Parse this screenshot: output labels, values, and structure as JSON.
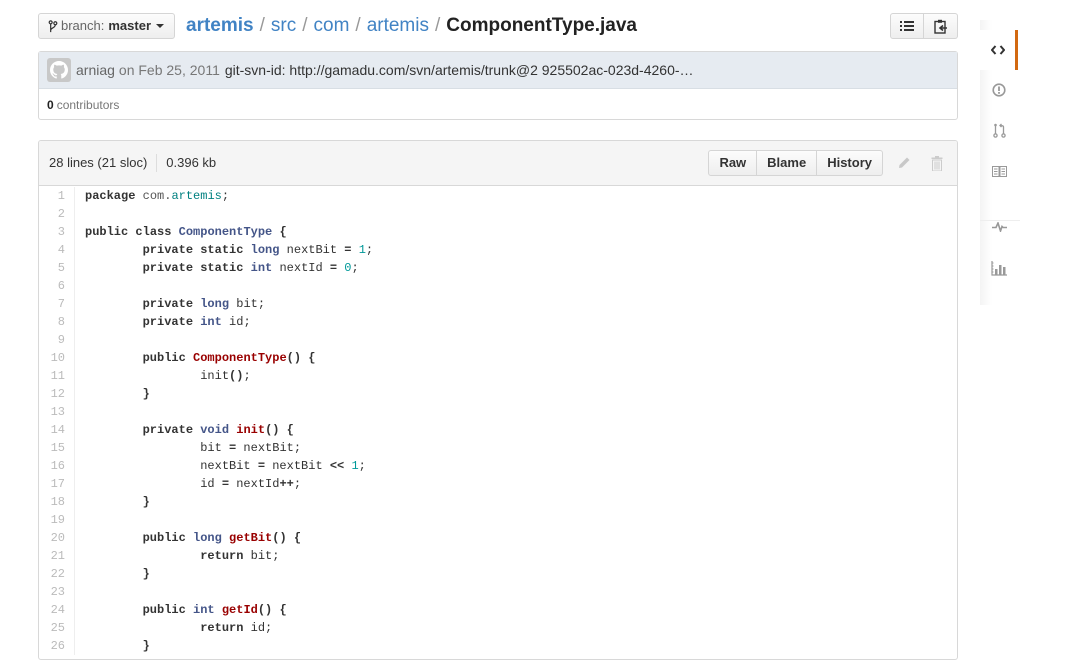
{
  "nav": {
    "branch_prefix": "branch:",
    "branch_name": "master",
    "breadcrumb": [
      {
        "label": "artemis",
        "kind": "repo"
      },
      {
        "label": "src",
        "kind": "dir"
      },
      {
        "label": "com",
        "kind": "dir"
      },
      {
        "label": "artemis",
        "kind": "dir"
      }
    ],
    "separator": "/",
    "file_name": "ComponentType.java",
    "toolbar_icons": [
      "list-icon",
      "clipboard-icon"
    ]
  },
  "commit": {
    "author": "arniag",
    "date_text": "on Feb 25, 2011",
    "message": "git-svn-id: http://gamadu.com/svn/artemis/trunk@2 925502ac-023d-4260-…",
    "contributors_count": "0",
    "contributors_label": "contributors"
  },
  "file": {
    "lines_info": "28 lines (21 sloc)",
    "size": "0.396 kb",
    "buttons": {
      "raw": "Raw",
      "blame": "Blame",
      "history": "History"
    }
  },
  "code_lines": [
    {
      "n": "1",
      "t": [
        [
          "k",
          "package"
        ],
        [
          "p",
          " "
        ],
        [
          "nn",
          "com."
        ],
        [
          "nna",
          "artemis"
        ],
        [
          "p",
          ";"
        ]
      ]
    },
    {
      "n": "2",
      "t": []
    },
    {
      "n": "3",
      "t": [
        [
          "k",
          "public"
        ],
        [
          "p",
          " "
        ],
        [
          "k",
          "class"
        ],
        [
          "p",
          " "
        ],
        [
          "nc",
          "ComponentType"
        ],
        [
          "p",
          " "
        ],
        [
          "o",
          "{"
        ]
      ]
    },
    {
      "n": "4",
      "t": [
        [
          "p",
          "        "
        ],
        [
          "k",
          "private"
        ],
        [
          "p",
          " "
        ],
        [
          "k",
          "static"
        ],
        [
          "p",
          " "
        ],
        [
          "kt",
          "long"
        ],
        [
          "p",
          " nextBit "
        ],
        [
          "o",
          "="
        ],
        [
          "p",
          " "
        ],
        [
          "mi",
          "1"
        ],
        [
          "p",
          ";"
        ]
      ]
    },
    {
      "n": "5",
      "t": [
        [
          "p",
          "        "
        ],
        [
          "k",
          "private"
        ],
        [
          "p",
          " "
        ],
        [
          "k",
          "static"
        ],
        [
          "p",
          " "
        ],
        [
          "kt",
          "int"
        ],
        [
          "p",
          " nextId "
        ],
        [
          "o",
          "="
        ],
        [
          "p",
          " "
        ],
        [
          "mi",
          "0"
        ],
        [
          "p",
          ";"
        ]
      ]
    },
    {
      "n": "6",
      "t": []
    },
    {
      "n": "7",
      "t": [
        [
          "p",
          "        "
        ],
        [
          "k",
          "private"
        ],
        [
          "p",
          " "
        ],
        [
          "kt",
          "long"
        ],
        [
          "p",
          " bit;"
        ]
      ]
    },
    {
      "n": "8",
      "t": [
        [
          "p",
          "        "
        ],
        [
          "k",
          "private"
        ],
        [
          "p",
          " "
        ],
        [
          "kt",
          "int"
        ],
        [
          "p",
          " id;"
        ]
      ]
    },
    {
      "n": "9",
      "t": []
    },
    {
      "n": "10",
      "t": [
        [
          "p",
          "        "
        ],
        [
          "k",
          "public"
        ],
        [
          "p",
          " "
        ],
        [
          "nf",
          "ComponentType"
        ],
        [
          "o",
          "()"
        ],
        [
          "p",
          " "
        ],
        [
          "o",
          "{"
        ]
      ]
    },
    {
      "n": "11",
      "t": [
        [
          "p",
          "                init"
        ],
        [
          "o",
          "()"
        ],
        [
          "p",
          ";"
        ]
      ]
    },
    {
      "n": "12",
      "t": [
        [
          "p",
          "        "
        ],
        [
          "o",
          "}"
        ]
      ]
    },
    {
      "n": "13",
      "t": []
    },
    {
      "n": "14",
      "t": [
        [
          "p",
          "        "
        ],
        [
          "k",
          "private"
        ],
        [
          "p",
          " "
        ],
        [
          "kt",
          "void"
        ],
        [
          "p",
          " "
        ],
        [
          "nf",
          "init"
        ],
        [
          "o",
          "()"
        ],
        [
          "p",
          " "
        ],
        [
          "o",
          "{"
        ]
      ]
    },
    {
      "n": "15",
      "t": [
        [
          "p",
          "                bit "
        ],
        [
          "o",
          "="
        ],
        [
          "p",
          " nextBit;"
        ]
      ]
    },
    {
      "n": "16",
      "t": [
        [
          "p",
          "                nextBit "
        ],
        [
          "o",
          "="
        ],
        [
          "p",
          " nextBit "
        ],
        [
          "o",
          "<<"
        ],
        [
          "p",
          " "
        ],
        [
          "mi",
          "1"
        ],
        [
          "p",
          ";"
        ]
      ]
    },
    {
      "n": "17",
      "t": [
        [
          "p",
          "                id "
        ],
        [
          "o",
          "="
        ],
        [
          "p",
          " nextId"
        ],
        [
          "o",
          "++"
        ],
        [
          "p",
          ";"
        ]
      ]
    },
    {
      "n": "18",
      "t": [
        [
          "p",
          "        "
        ],
        [
          "o",
          "}"
        ]
      ]
    },
    {
      "n": "19",
      "t": []
    },
    {
      "n": "20",
      "t": [
        [
          "p",
          "        "
        ],
        [
          "k",
          "public"
        ],
        [
          "p",
          " "
        ],
        [
          "kt",
          "long"
        ],
        [
          "p",
          " "
        ],
        [
          "nf",
          "getBit"
        ],
        [
          "o",
          "()"
        ],
        [
          "p",
          " "
        ],
        [
          "o",
          "{"
        ]
      ]
    },
    {
      "n": "21",
      "t": [
        [
          "p",
          "                "
        ],
        [
          "k",
          "return"
        ],
        [
          "p",
          " bit;"
        ]
      ]
    },
    {
      "n": "22",
      "t": [
        [
          "p",
          "        "
        ],
        [
          "o",
          "}"
        ]
      ]
    },
    {
      "n": "23",
      "t": []
    },
    {
      "n": "24",
      "t": [
        [
          "p",
          "        "
        ],
        [
          "k",
          "public"
        ],
        [
          "p",
          " "
        ],
        [
          "kt",
          "int"
        ],
        [
          "p",
          " "
        ],
        [
          "nf",
          "getId"
        ],
        [
          "o",
          "()"
        ],
        [
          "p",
          " "
        ],
        [
          "o",
          "{"
        ]
      ]
    },
    {
      "n": "25",
      "t": [
        [
          "p",
          "                "
        ],
        [
          "k",
          "return"
        ],
        [
          "p",
          " id;"
        ]
      ]
    },
    {
      "n": "26",
      "t": [
        [
          "p",
          "        "
        ],
        [
          "o",
          "}"
        ]
      ]
    }
  ],
  "sidebar": {
    "items": [
      {
        "name": "code",
        "icon": "code-icon",
        "selected": true
      },
      {
        "name": "issues",
        "icon": "issue-opened-icon",
        "selected": false
      },
      {
        "name": "pull-requests",
        "icon": "git-pull-request-icon",
        "selected": false
      },
      {
        "name": "wiki",
        "icon": "book-icon",
        "selected": false
      },
      {
        "name": "pulse",
        "icon": "pulse-icon",
        "selected": false
      },
      {
        "name": "graphs",
        "icon": "graph-icon",
        "selected": false
      }
    ],
    "accent_color": "#d26911"
  },
  "colors": {
    "link": "#4183c4",
    "keyword_type": "#445588",
    "function_name": "#990000",
    "number": "#009999"
  }
}
